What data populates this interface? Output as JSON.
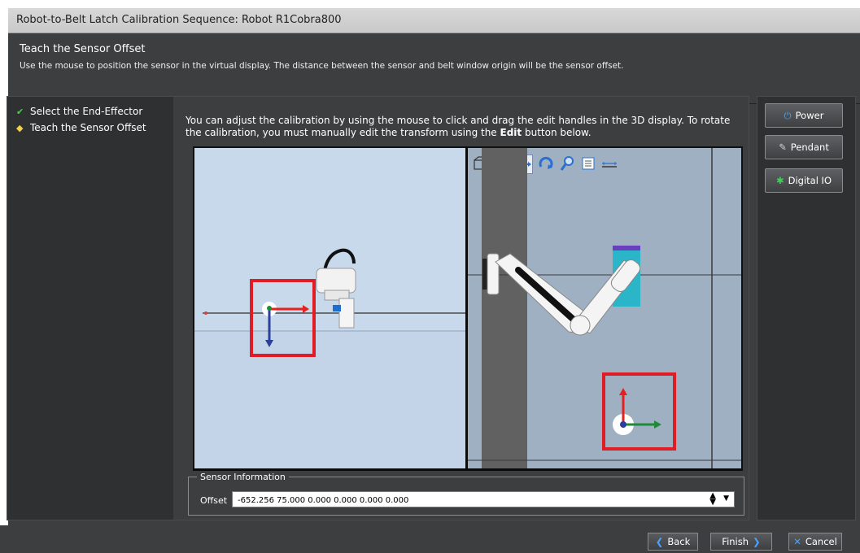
{
  "window": {
    "title": "Robot-to-Belt Latch Calibration Sequence: Robot R1Cobra800"
  },
  "header": {
    "title": "Teach the Sensor Offset",
    "description": "Use the mouse to position the sensor in the virtual display. The distance between the sensor and belt window origin will be the sensor offset."
  },
  "steps": [
    {
      "label": "Select the End-Effector",
      "icon": "check-icon"
    },
    {
      "label": "Teach the Sensor Offset",
      "icon": "current-step-icon"
    }
  ],
  "main": {
    "instruction_pre": "You can adjust the calibration by using the mouse to click and drag the edit handles in the 3D display. To rotate the calibration, you must manually edit the transform using the ",
    "instruction_bold": "Edit",
    "instruction_post": " button below."
  },
  "sensor": {
    "legend": "Sensor Information",
    "offset_label": "Offset",
    "offset_value": "-652.256 75.000 0.000 0.000 0.000 0.000"
  },
  "right_buttons": [
    {
      "label": "Power",
      "icon": "power-icon"
    },
    {
      "label": "Pendant",
      "icon": "pendant-icon"
    },
    {
      "label": "Digital IO",
      "icon": "digital-io-icon"
    }
  ],
  "footer": {
    "back": "Back",
    "finish": "Finish",
    "cancel": "Cancel"
  },
  "colors": {
    "highlight_red": "#e01c24",
    "axis_red": "#e52020",
    "axis_green": "#1f8a3a",
    "axis_blue": "#2b3f9c"
  }
}
